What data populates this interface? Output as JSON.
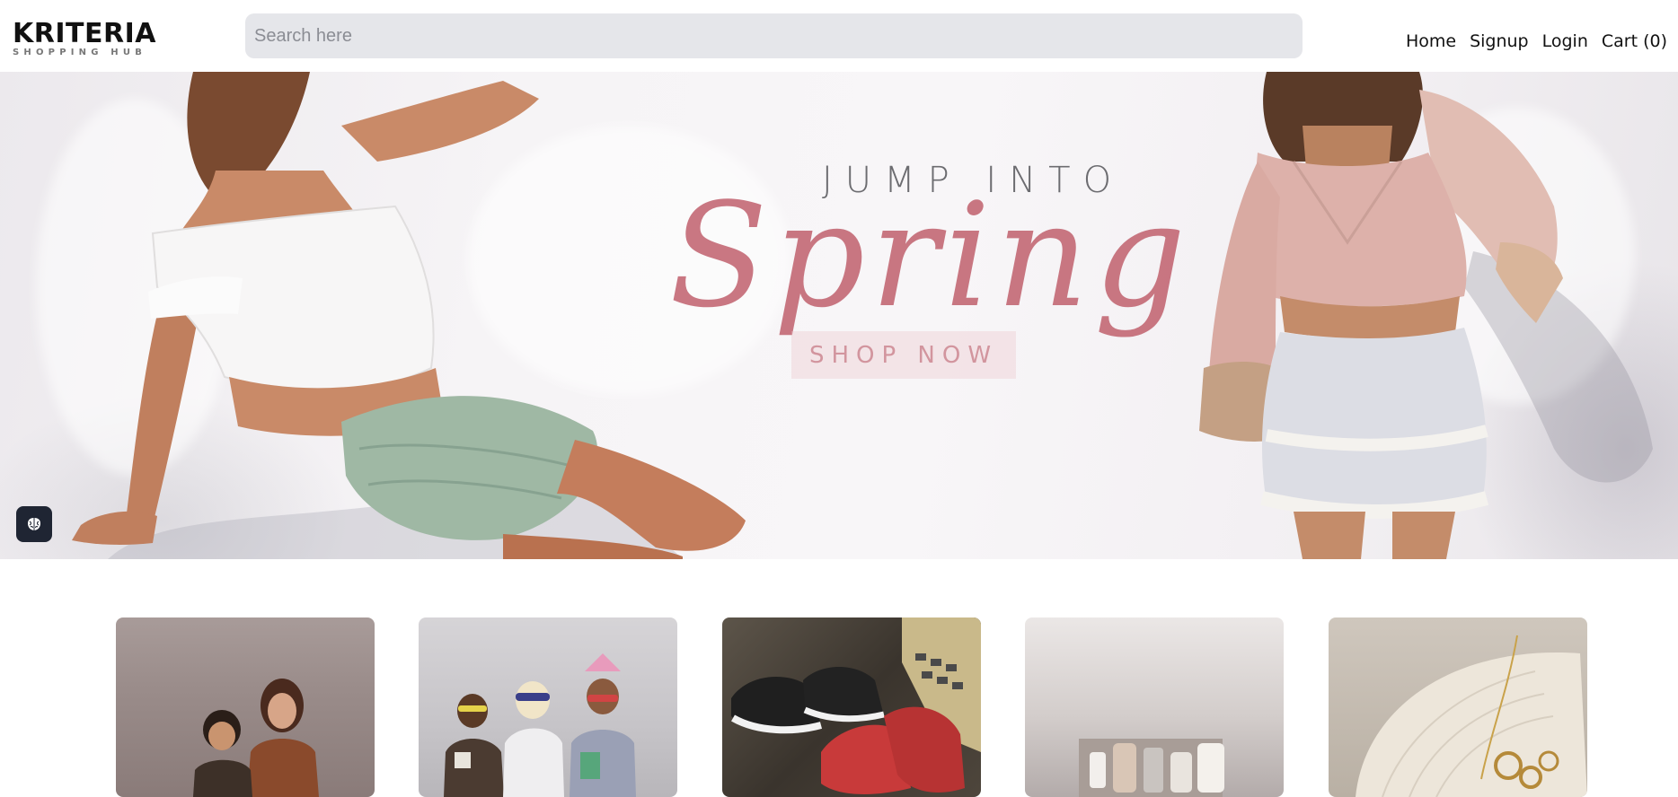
{
  "brand": {
    "name": "KRITERIA",
    "tagline": "SHOPPING HUB"
  },
  "search": {
    "placeholder": "Search here",
    "value": ""
  },
  "nav": [
    {
      "label": "Home"
    },
    {
      "label": "Signup"
    },
    {
      "label": "Login"
    },
    {
      "label": "Cart (0)"
    }
  ],
  "hero": {
    "line1": "JUMP INTO",
    "line2": "Spring",
    "cta": "SHOP NOW"
  },
  "theme_toggle": {
    "icon": "brain-icon"
  },
  "categories": [
    {
      "name": "category-women-men",
      "icon": "family-photo"
    },
    {
      "name": "category-kids",
      "icon": "kids-photo"
    },
    {
      "name": "category-shoes",
      "icon": "sneakers-photo"
    },
    {
      "name": "category-beauty",
      "icon": "cosmetics-photo"
    },
    {
      "name": "category-jewelry",
      "icon": "jewelry-photo"
    }
  ],
  "colors": {
    "search_bg": "#e5e6ea",
    "spring_accent": "#c05f6c",
    "toggle_bg": "#1f2533"
  }
}
